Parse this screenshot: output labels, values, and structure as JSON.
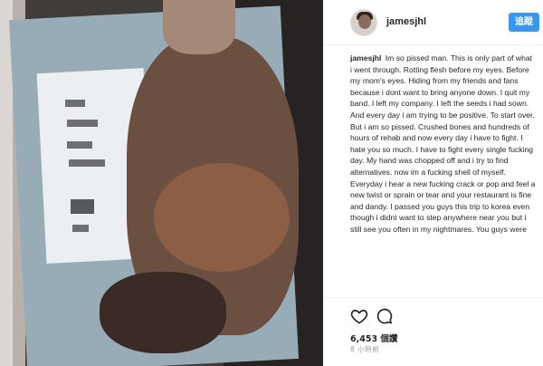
{
  "post": {
    "username": "jamesjhl",
    "follow_label": "追蹤",
    "caption_user": "jamesjhl",
    "caption_text": "Im so pissed man. This is only part of what i went through. Rotting flesh before my eyes. Before my mom's eyes. Hiding from my friends and fans because i dont want to bring anyone down. I quit my band. I left my company. I left the seeds i had sown. And every day i am trying to be positive. To start over. But i am so pissed. Crushed bones and hundreds of hours of rehab and now every day i have to fight. I hate you so much. I have to fight every single fucking day. My hand was chopped off and i try to find alternatives. now im a fucking shell of myself. Everyday i hear a new fucking crack or pop and feel a new twist or sprain or tear and your restaurant is fine and dandy. I passed you guys this trip to korea even though i didnt want to step anywhere near you but i still see you often in my nightmares. You guys were",
    "likes": "6,453 個讚",
    "time_ago": "8 小時前"
  },
  "icons": {
    "like": "heart-icon",
    "comment": "comment-bubble-icon"
  },
  "colors": {
    "follow_button": "#3897f0",
    "text": "#262626",
    "muted": "#999999"
  }
}
